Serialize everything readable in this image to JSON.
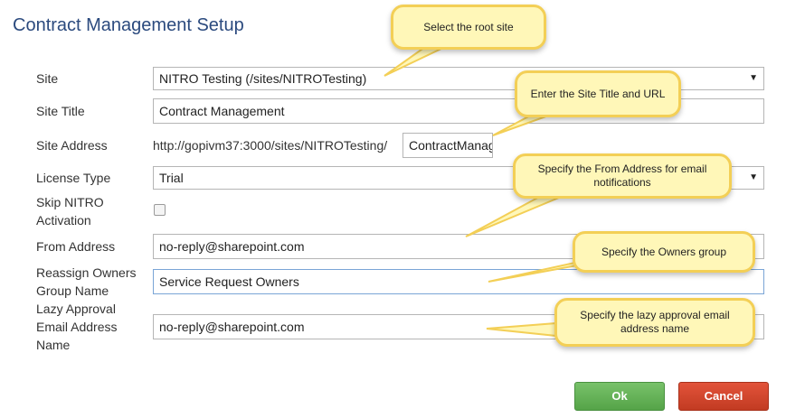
{
  "page": {
    "title": "Contract Management Setup"
  },
  "form": {
    "site": {
      "label": "Site",
      "value": "NITRO Testing (/sites/NITROTesting)",
      "arrow": "▼"
    },
    "site_title": {
      "label": "Site Title",
      "value": "Contract Management"
    },
    "site_address": {
      "label": "Site Address",
      "prefix": "http://gopivm37:3000/sites/NITROTesting/",
      "value": "ContractManagement"
    },
    "license_type": {
      "label": "License Type",
      "value": "Trial",
      "arrow": "▼"
    },
    "skip_activation": {
      "label_line1": "Skip NITRO",
      "label_line2": "Activation",
      "checked": false
    },
    "from_address": {
      "label": "From Address",
      "value": "no-reply@sharepoint.com"
    },
    "owners_group": {
      "label_line1": "Reassign Owners",
      "label_line2": "Group Name",
      "value": "Service Request Owners"
    },
    "lazy_approval": {
      "label_line1": "Lazy Approval",
      "label_line2": "Email Address",
      "label_line3": "Name",
      "value": "no-reply@sharepoint.com"
    }
  },
  "callouts": {
    "root_site": "Select the root site",
    "site_title_url": "Enter the Site Title and URL",
    "from_address": "Specify the From Address for email notifications",
    "owners_group": "Specify the Owners group",
    "lazy_approval": "Specify the lazy approval email address name"
  },
  "buttons": {
    "ok": "Ok",
    "cancel": "Cancel"
  },
  "colors": {
    "title": "#2b4a7e",
    "callout_fill": "#fff7b8",
    "callout_border": "#f3cf56",
    "ok": "#5cab4e",
    "cancel": "#d4472e"
  }
}
